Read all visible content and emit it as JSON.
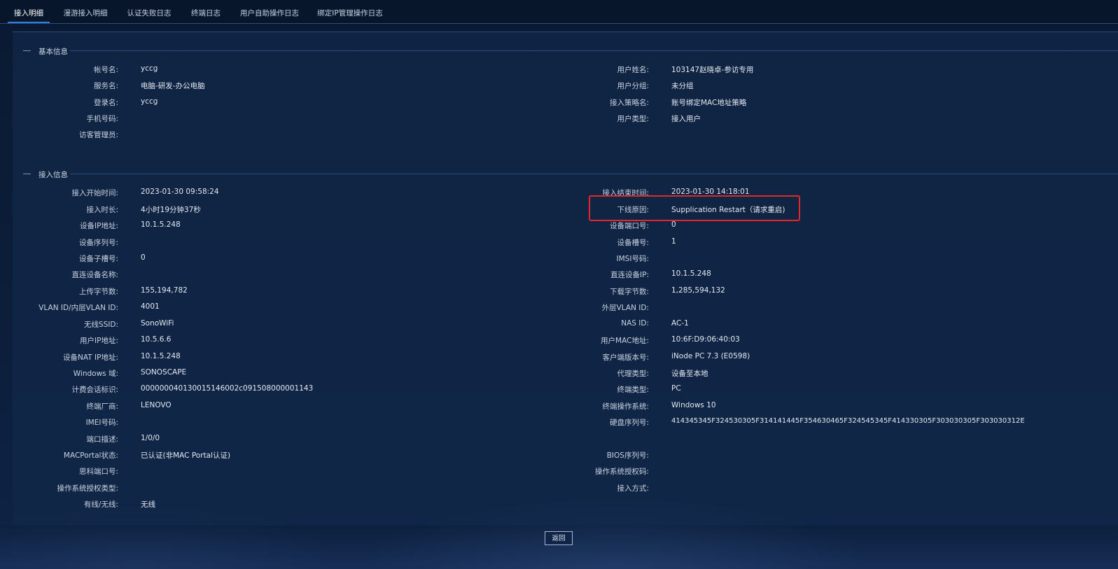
{
  "tabs": [
    {
      "label": "接入明细",
      "active": true
    },
    {
      "label": "漫游接入明细",
      "active": false
    },
    {
      "label": "认证失败日志",
      "active": false
    },
    {
      "label": "终端日志",
      "active": false
    },
    {
      "label": "用户自助操作日志",
      "active": false
    },
    {
      "label": "绑定IP管理操作日志",
      "active": false
    }
  ],
  "basic_info": {
    "title": "基本信息",
    "left": [
      {
        "label": "帐号名:",
        "value": "yccg"
      },
      {
        "label": "服务名:",
        "value": "电脑-研发-办公电脑"
      },
      {
        "label": "登录名:",
        "value": "yccg"
      },
      {
        "label": "手机号码:",
        "value": ""
      },
      {
        "label": "访客管理员:",
        "value": ""
      }
    ],
    "right": [
      {
        "label": "用户姓名:",
        "value": "103147赵晓卓-参访专用"
      },
      {
        "label": "用户分组:",
        "value": "未分组"
      },
      {
        "label": "接入策略名:",
        "value": "账号绑定MAC地址策略"
      },
      {
        "label": "用户类型:",
        "value": "接入用户"
      }
    ]
  },
  "access_info": {
    "title": "接入信息",
    "left": [
      {
        "label": "接入开始时间:",
        "value": "2023-01-30 09:58:24"
      },
      {
        "label": "接入时长:",
        "value": "4小时19分钟37秒"
      },
      {
        "label": "设备IP地址:",
        "value": "10.1.5.248"
      },
      {
        "label": "设备序列号:",
        "value": ""
      },
      {
        "label": "设备子槽号:",
        "value": "0"
      },
      {
        "label": "直连设备名称:",
        "value": ""
      },
      {
        "label": "上传字节数:",
        "value": "155,194,782"
      },
      {
        "label": "VLAN ID/内层VLAN ID:",
        "value": "4001"
      },
      {
        "label": "无线SSID:",
        "value": "SonoWiFi"
      },
      {
        "label": "用户IP地址:",
        "value": "10.5.6.6"
      },
      {
        "label": "设备NAT IP地址:",
        "value": "10.1.5.248"
      },
      {
        "label": "Windows 域:",
        "value": "SONOSCAPE"
      },
      {
        "label": "计费会话标识:",
        "value": "00000004013001514600​2c091508000001143"
      },
      {
        "label": "终端厂商:",
        "value": "LENOVO"
      },
      {
        "label": "IMEI号码:",
        "value": ""
      },
      {
        "label": "端口描述:",
        "value": "1/0/0"
      },
      {
        "label": "MACPortal状态:",
        "value": "已认证(非MAC Portal认证)"
      },
      {
        "label": "思科端口号:",
        "value": ""
      },
      {
        "label": "操作系统授权类型:",
        "value": ""
      },
      {
        "label": "有线/无线:",
        "value": "无线"
      }
    ],
    "right": [
      {
        "label": "接入结束时间:",
        "value": "2023-01-30 14:18:01"
      },
      {
        "label": "下线原因:",
        "value": "Supplication Restart（请求重启)"
      },
      {
        "label": "设备端口号:",
        "value": "0"
      },
      {
        "label": "设备槽号:",
        "value": "1"
      },
      {
        "label": "IMSI号码:",
        "value": ""
      },
      {
        "label": "直连设备IP:",
        "value": "10.1.5.248"
      },
      {
        "label": "下载字节数:",
        "value": "1,285,594,132"
      },
      {
        "label": "外层VLAN ID:",
        "value": ""
      },
      {
        "label": "NAS ID:",
        "value": "AC-1"
      },
      {
        "label": "用户MAC地址:",
        "value": "10:6F:D9:06:40:03"
      },
      {
        "label": "客户端版本号:",
        "value": "iNode PC 7.3 (E0598)"
      },
      {
        "label": "代理类型:",
        "value": "设备至本地"
      },
      {
        "label": "终端类型:",
        "value": "PC"
      },
      {
        "label": "终端操作系统:",
        "value": "Windows 10"
      },
      {
        "label": "硬盘序列号:",
        "value": "414345345F324530305F314141445F354630465F324545345F414330305F303030305F303030312E"
      },
      {
        "label": "BIOS序列号:",
        "value": ""
      },
      {
        "label": "操作系统授权码:",
        "value": ""
      },
      {
        "label": "接入方式:",
        "value": ""
      }
    ]
  },
  "back_button": "返回",
  "colors": {
    "background": "#0b1a33",
    "tab_active_underline": "#2f7fe0",
    "highlight_border": "#e2262a"
  }
}
